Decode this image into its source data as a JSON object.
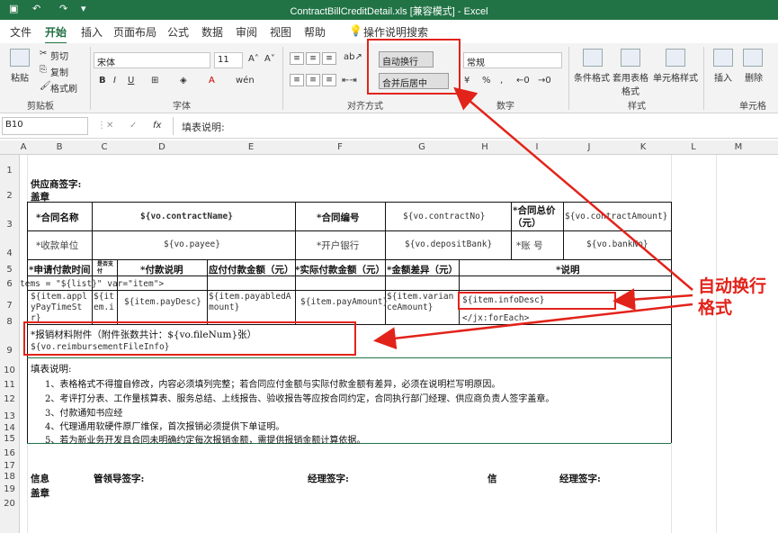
{
  "window": {
    "title": "ContractBillCreditDetail.xls  [兼容模式]  -  Excel",
    "save_icon": "save-icon"
  },
  "tabs": [
    "文件",
    "开始",
    "插入",
    "页面布局",
    "公式",
    "数据",
    "审阅",
    "视图",
    "帮助",
    "操作说明搜索"
  ],
  "ribbon": {
    "clipboard": {
      "label": "剪贴板",
      "paste": "粘贴",
      "cut": "剪切",
      "copy": "复制",
      "painter": "格式刷"
    },
    "font": {
      "label": "字体",
      "name": "宋体",
      "size": "11",
      "bold": "B",
      "italic": "I",
      "underline": "U"
    },
    "alignment": {
      "label": "对齐方式",
      "wrap": "自动换行",
      "merge": "合并后居中"
    },
    "number": {
      "label": "数字",
      "format": "常规",
      "percent": "%",
      "comma": ","
    },
    "styles": {
      "label": "样式",
      "conditional": "条件格式",
      "table": "套用表格格式",
      "cell": "单元格样式"
    },
    "cells": {
      "label": "单元格",
      "insert": "插入",
      "delete": "删除"
    }
  },
  "formula": {
    "namebox": "B10",
    "fx": "fx",
    "content": "填表说明:"
  },
  "columns": [
    "A",
    "B",
    "C",
    "D",
    "E",
    "F",
    "G",
    "H",
    "I",
    "J",
    "K",
    "L",
    "M"
  ],
  "rows": [
    "1",
    "2",
    "3",
    "4",
    "5",
    "6",
    "7",
    "8",
    "9",
    "10",
    "11",
    "12",
    "13",
    "14",
    "15",
    "16",
    "17",
    "18",
    "19",
    "20"
  ],
  "sheet": {
    "supplier_sign": "供应商签字:",
    "stamp": "盖章",
    "contract_name_label": "*合同名称",
    "contract_name": "${vo.contractName}",
    "contract_no_label": "*合同编号",
    "contract_no": "${vo.contractNo}",
    "contract_total_label": "*合同总价（元）",
    "contract_total": "${vo.contractAmount}",
    "payee_label": "*收款单位",
    "payee": "${vo.payee}",
    "bank_label": "*开户银行",
    "bank": "${vo.depositBank}",
    "account_label": "*账    号",
    "account": "${vo.bankNo}",
    "h_apply": "*申请付款时间",
    "h_tiny": "是否支付",
    "h_desc": "*付款说明",
    "h_payable": "应付付款金额（元）",
    "h_actual": "*实际付款金额（元）",
    "h_diff": "*金额差异（元）",
    "h_note": "*说明",
    "foreach": "tems = \"${list}\" var=\"item\">",
    "r7_b": "${item.applyPayTimeStr}",
    "r7_c": "${item.i",
    "r7_d": "${item.payDesc}",
    "r7_e": "${item.payabledAmount}",
    "r7_f": "${item.payAmount}",
    "r7_g": "${item.varianceAmount}",
    "r7_h": "${item.infoDesc}",
    "end_foreach": "</jx:forEach>",
    "attach_line": "*报销材料附件（附件张数共计：${vo.fileNum}张）",
    "attach_info": "${vo.reimbursementFileInfo}",
    "notes_title": "填表说明:",
    "note1": "1、表格格式不得擅自修改，内容必须填列完整；若合同应付金额与实际付款金额有差异，必须在说明栏写明原因。",
    "note2": "2、考评打分表、工作量核算表、服务总结、上线报告、验收报告等应按合同约定，合同执行部门经理、供应商负责人签字盖章。",
    "note3": "3、付款通知书应经",
    "note4": "4、代理通用软硬件原厂维保，首次报销必须提供下单证明。",
    "note5": "5、若为新业务开发且合同未明确约定每次报销金额，需提供报销金额计算依据。",
    "sig_info": "信息",
    "sig_lead": "管领导签字:",
    "sig_mgr": "经理签字:",
    "sig_info2": "信",
    "sig_gm": "经理签字:",
    "sig_stamp": "盖章"
  },
  "annotation": {
    "line1": "自动换行",
    "line2": "格式",
    "color": "#e2231a"
  }
}
